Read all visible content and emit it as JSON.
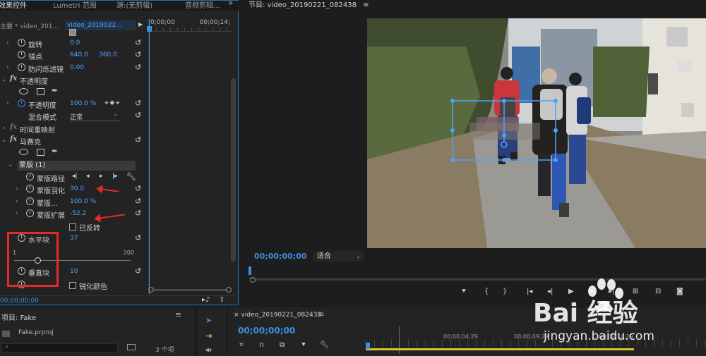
{
  "effect_controls": {
    "tabs": [
      "效果控件",
      "Lumetri 范围",
      "源:(无剪辑)",
      "音频剪辑..."
    ],
    "master_label": "主要 * video_201...",
    "clip_label": "video_2019022...",
    "timeline_start": "0;00;00",
    "timeline_end": "00;00;14;",
    "rows": {
      "rotation": {
        "label": "旋转",
        "value": "0.0"
      },
      "anchor": {
        "label": "锚点",
        "value_x": "640.0",
        "value_y": "360.0"
      },
      "anti_flicker": {
        "label": "防闪烁滤镜",
        "value": "0.00"
      },
      "opacity_section": "不透明度",
      "opacity": {
        "label": "不透明度",
        "value": "100.0 %"
      },
      "blend_mode": {
        "label": "混合模式",
        "value": "正常"
      },
      "time_remap": "时间重映射",
      "mosaic_section": "马赛克",
      "mask": "蒙版 (1)",
      "mask_path": "蒙版路径",
      "mask_feather": {
        "label": "蒙版羽化",
        "value": "30.0"
      },
      "mask_opacity": {
        "label": "蒙版...",
        "value": "100.0 %"
      },
      "mask_expansion": {
        "label": "蒙版扩展",
        "value": "-52.2"
      },
      "inverted": "已反转",
      "horizontal_blocks": {
        "label": "水平块",
        "value": "37"
      },
      "slider_min": "1",
      "slider_max": "200",
      "slider_fraction": 0.18,
      "vertical_blocks": {
        "label": "垂直块",
        "value": "10"
      },
      "sharpen_colors": "锐化颜色"
    },
    "footer_timecode": "00;00;00;00"
  },
  "program_monitor": {
    "title": "节目: video_20190221_082438",
    "timecode": "00;00;00;00",
    "fit_label": "适合"
  },
  "project": {
    "title": "项目: Fake",
    "file": "Fake.prproj",
    "count": "3 个项"
  },
  "sequence": {
    "title": "video_20190221_082438",
    "timecode": "00;00;00;00",
    "ruler_labels": [
      "00;00;04;29",
      "00;00;09;29",
      "00;00;14;29"
    ]
  },
  "watermark": {
    "brand": "Bai 经验",
    "url": "jingyan.baidu.com"
  },
  "colors": {
    "accent_blue": "#3b8de0",
    "value_blue": "#4fa3ff",
    "annotation_red": "#e32b2b"
  }
}
